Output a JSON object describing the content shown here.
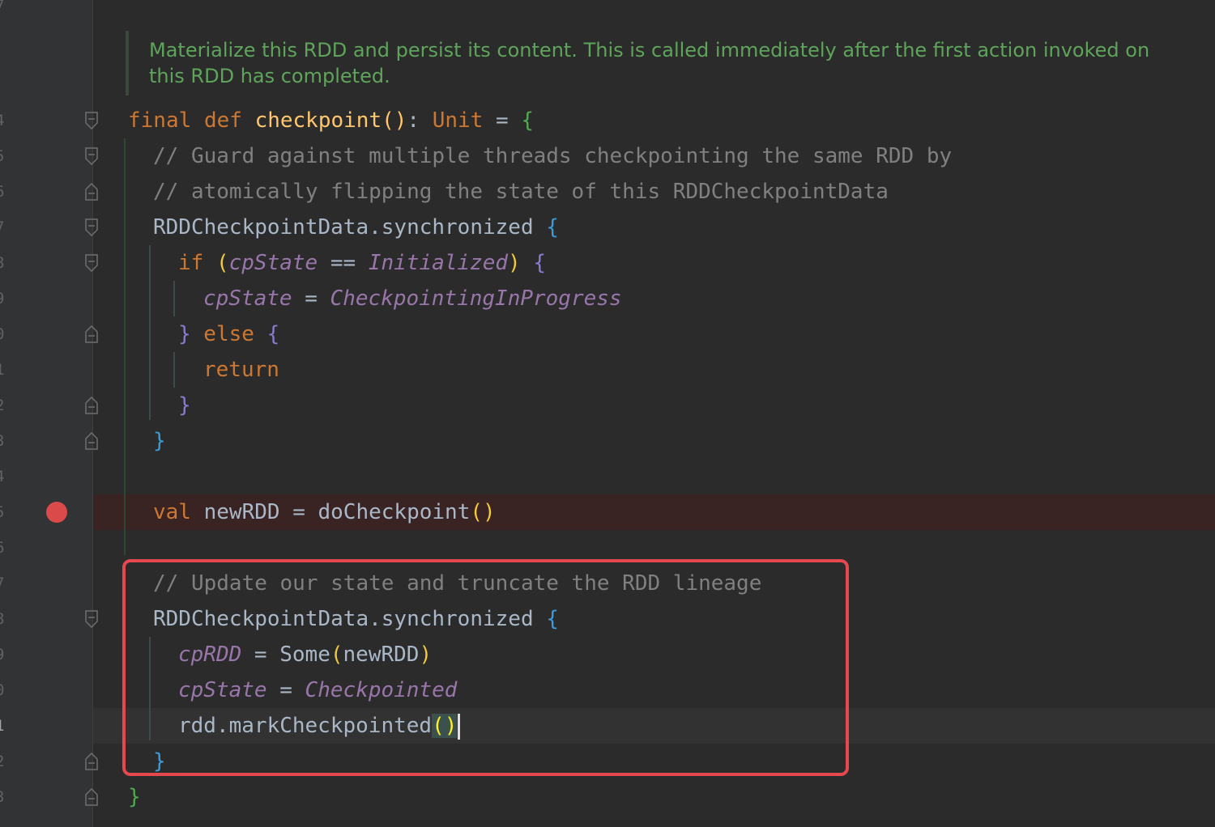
{
  "doc_comment": "Materialize this RDD and persist its content. This is called immediately after the first action invoked on this RDD has completed.",
  "line_numbers": [
    "4",
    "5",
    "6",
    "7",
    "8",
    "9",
    "0",
    "1",
    "2",
    "3",
    "4",
    "5",
    "6",
    "7",
    "8",
    "9",
    "0",
    "1",
    "2",
    "3"
  ],
  "top_line_number": "7",
  "code": {
    "l1": {
      "final": "final",
      "def": "def",
      "name": "checkpoint",
      "parens": "()",
      "colon": ": ",
      "unit": "Unit",
      "eq": " = ",
      "brace": "{"
    },
    "l2": "// Guard against multiple threads checkpointing the same RDD by",
    "l3": "// atomically flipping the state of this RDDCheckpointData",
    "l4": {
      "obj": "RDDCheckpointData.synchronized ",
      "brace": "{"
    },
    "l5": {
      "if": "if ",
      "lp": "(",
      "var": "cpState",
      "op": " == ",
      "val": "Initialized",
      "rp": ")",
      "brace": " {"
    },
    "l6": {
      "var": "cpState",
      "op": " = ",
      "val": "CheckpointingInProgress"
    },
    "l7": {
      "rb": "}",
      "else": " else ",
      "lb": "{"
    },
    "l8": "return",
    "l9": "}",
    "l10": "}",
    "l12": {
      "val": "val",
      "rest": " newRDD = doCheckpoint",
      "parens": "()"
    },
    "l14": "// Update our state and truncate the RDD lineage",
    "l15": {
      "obj": "RDDCheckpointData.synchronized ",
      "brace": "{"
    },
    "l16": {
      "var": "cpRDD",
      "op": " = ",
      "some": "Some",
      "lp": "(",
      "arg": "newRDD",
      "rp": ")"
    },
    "l17": {
      "var": "cpState",
      "op": " = ",
      "val": "Checkpointed"
    },
    "l18": {
      "call": "rdd.markCheckpointed",
      "parens": "()"
    },
    "l19": "}",
    "l20": "}"
  },
  "colors": {
    "breakpoint": "#db4a4a",
    "highlight_box": "#e5484d",
    "doc_comment": "#5ea45a"
  }
}
